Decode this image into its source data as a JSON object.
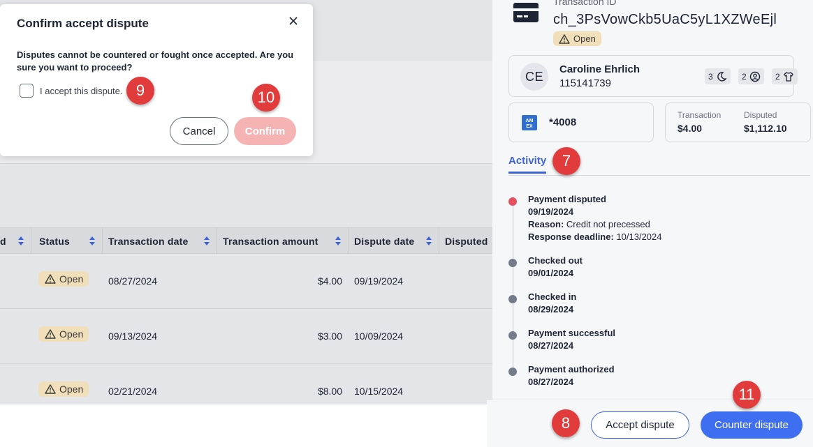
{
  "modal": {
    "title": "Confirm accept dispute",
    "message": "Disputes cannot be countered or fought once accepted. Are you sure you want to proceed?",
    "checkbox_label": "I accept this dispute.",
    "cancel_label": "Cancel",
    "confirm_label": "Confirm",
    "close_icon": "close-icon"
  },
  "table": {
    "columns": [
      "d",
      "Status",
      "Transaction date",
      "Transaction amount",
      "Dispute date",
      "Disputed"
    ],
    "rows": [
      {
        "status": "Open",
        "transaction_date": "08/27/2024",
        "amount": "$4.00",
        "dispute_date": "09/19/2024"
      },
      {
        "status": "Open",
        "transaction_date": "09/13/2024",
        "amount": "$3.00",
        "dispute_date": "10/09/2024"
      },
      {
        "status": "Open",
        "transaction_date": "02/21/2024",
        "amount": "$8.00",
        "dispute_date": "10/15/2024"
      }
    ]
  },
  "panel": {
    "tx_label": "Transaction ID",
    "tx_id": "ch_3PsVowCkb5UaC5yL1XZWeEjl",
    "status": "Open",
    "customer": {
      "initials": "CE",
      "name": "Caroline Ehrlich",
      "number": "115141739",
      "stats": [
        {
          "count": "3",
          "icon": "moon-icon"
        },
        {
          "count": "2",
          "icon": "user-circle-icon"
        },
        {
          "count": "2",
          "icon": "shirt-icon"
        }
      ]
    },
    "payment": {
      "card_brand_icon": "amex-icon",
      "last4": "*4008"
    },
    "amounts": {
      "transaction_label": "Transaction",
      "transaction_value": "$4.00",
      "disputed_label": "Disputed",
      "disputed_value": "$1,112.10"
    },
    "tab_label": "Activity",
    "activity": [
      {
        "title": "Payment disputed",
        "date": "09/19/2024",
        "reason_label": "Reason:",
        "reason": "Credit not precessed",
        "deadline_label": "Response deadline:",
        "deadline": "10/13/2024"
      },
      {
        "title": "Checked out",
        "date": "09/01/2024"
      },
      {
        "title": "Checked in",
        "date": "08/29/2024"
      },
      {
        "title": "Payment successful",
        "date": "08/27/2024"
      },
      {
        "title": "Payment authorized",
        "date": "08/27/2024"
      }
    ],
    "accept_label": "Accept dispute",
    "counter_label": "Counter dispute"
  },
  "markers": [
    "7",
    "8",
    "9",
    "10",
    "11"
  ],
  "colors": {
    "accent": "#3e63d8",
    "primary_button": "#3e6ff0",
    "marker": "#e23b3b",
    "open_badge": "#f0dfb8",
    "disputed_dot": "#e5505e",
    "confirm_disabled": "#f5b3b3"
  }
}
